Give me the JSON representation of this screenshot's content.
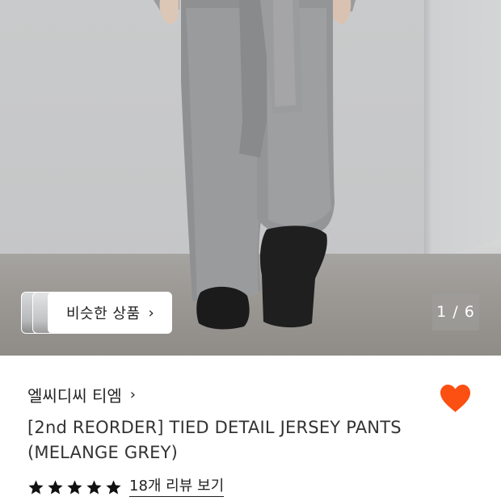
{
  "gallery": {
    "similar_label": "비슷한 상품",
    "chevron": "›",
    "counter": "1 / 6"
  },
  "product": {
    "brand": "엘씨디씨 티엠",
    "brand_chevron": "›",
    "title": "[2nd REORDER] TIED DETAIL JERSEY PANTS (MELANGE GREY)",
    "rating_stars": 5,
    "review_link": "18개 리뷰 보기"
  },
  "colors": {
    "heart": "#fc4f12",
    "text": "#222222",
    "star": "#111111"
  },
  "icons": {
    "heart": "heart-icon",
    "star": "star-icon",
    "chevron": "chevron-right-icon"
  }
}
